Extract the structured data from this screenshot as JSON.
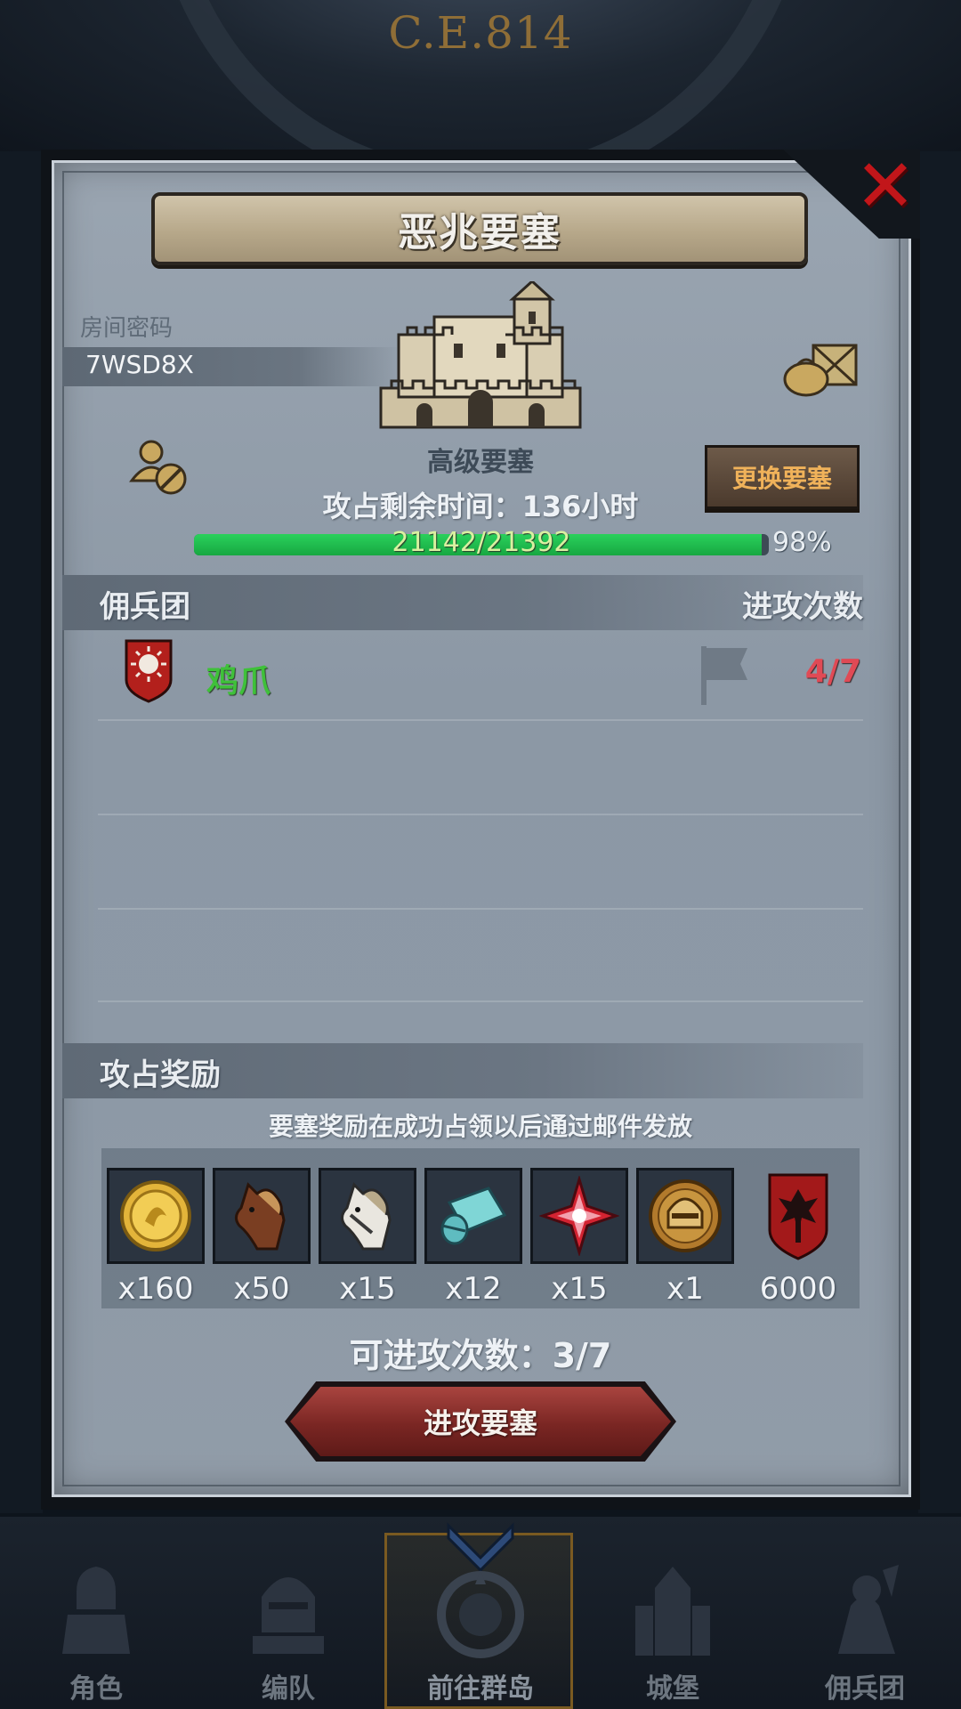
{
  "header": {
    "year_text": "C.E.814"
  },
  "modal": {
    "title": "恶兆要塞",
    "room": {
      "label": "房间密码",
      "code": "7WSD8X"
    },
    "fortress": {
      "level": "高级要塞",
      "change_button": "更换要塞"
    },
    "capture": {
      "time_text": "攻占剩余时间：136小时",
      "hp_text": "21142/21392",
      "hp_percent_text": "98%",
      "hp_fraction": 0.988
    },
    "guild_section": {
      "left_header": "佣兵团",
      "right_header": "进攻次数",
      "rows": [
        {
          "name": "鸡爪",
          "attacks": "4/7"
        }
      ]
    },
    "rewards": {
      "header": "攻占奖励",
      "note": "要塞奖励在成功占领以后通过邮件发放",
      "items": [
        {
          "icon": "gold-coin-icon",
          "qty": "x160"
        },
        {
          "icon": "brown-horse-icon",
          "qty": "x50"
        },
        {
          "icon": "white-horse-icon",
          "qty": "x15"
        },
        {
          "icon": "cloth-roll-icon",
          "qty": "x12"
        },
        {
          "icon": "red-star-crystal-icon",
          "qty": "x15"
        },
        {
          "icon": "knight-helmet-coin-icon",
          "qty": "x1"
        },
        {
          "icon": "mercenary-banner-icon",
          "qty": "6000"
        }
      ]
    },
    "remaining_attacks": "可进攻次数：3/7",
    "attack_button": "进攻要塞",
    "colors": {
      "accent_green": "#3fc13a",
      "accent_red": "#e04a55",
      "button_red": "#7a2623"
    }
  },
  "bottom_nav": {
    "items": [
      {
        "label": "角色",
        "icon": "knight-icon"
      },
      {
        "label": "编队",
        "icon": "helmet-formation-icon"
      },
      {
        "label": "前往群岛",
        "icon": "compass-icon",
        "active": true
      },
      {
        "label": "城堡",
        "icon": "castle-icon"
      },
      {
        "label": "佣兵团",
        "icon": "mercenary-icon"
      }
    ]
  }
}
